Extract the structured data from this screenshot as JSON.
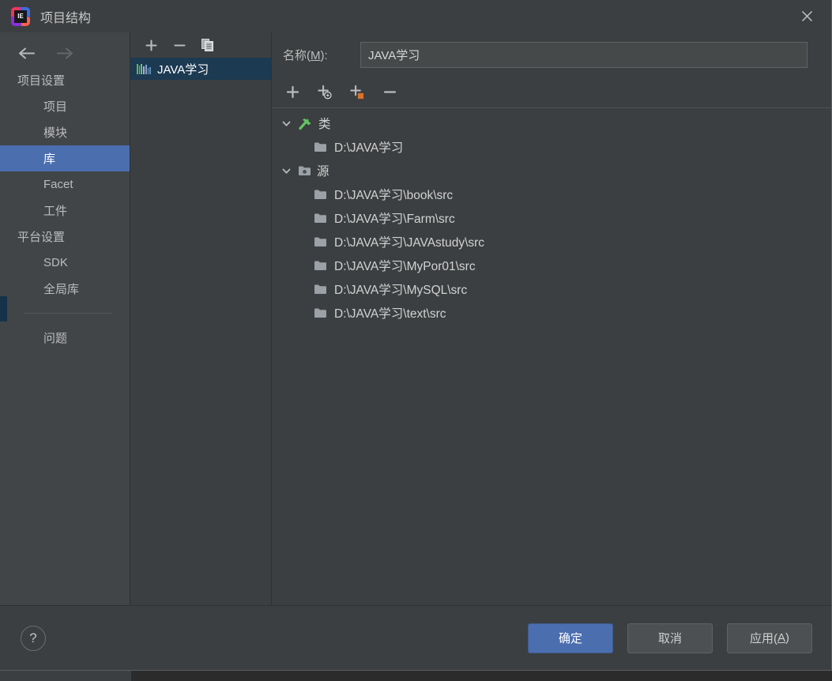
{
  "window": {
    "title": "项目结构",
    "app_icon": "intellij-idea-logo",
    "logo_badge": "IE",
    "close_icon": "close-icon"
  },
  "sidebar": {
    "back_icon": "arrow-left-icon",
    "forward_icon": "arrow-right-icon",
    "items": [
      {
        "label": "项目设置",
        "type": "group",
        "selected": false
      },
      {
        "label": "项目",
        "type": "child",
        "selected": false
      },
      {
        "label": "模块",
        "type": "child",
        "selected": false
      },
      {
        "label": "库",
        "type": "child",
        "selected": true
      },
      {
        "label": "Facet",
        "type": "child",
        "selected": false
      },
      {
        "label": "工件",
        "type": "child",
        "selected": false
      },
      {
        "label": "平台设置",
        "type": "group",
        "selected": false
      },
      {
        "label": "SDK",
        "type": "child",
        "selected": false
      },
      {
        "label": "全局库",
        "type": "child",
        "selected": false
      }
    ],
    "after_separator": [
      {
        "label": "问题",
        "type": "child",
        "selected": false
      }
    ]
  },
  "libraries_panel": {
    "toolbar": [
      {
        "name": "add-library-button",
        "icon": "plus-icon"
      },
      {
        "name": "remove-library-button",
        "icon": "minus-icon"
      },
      {
        "name": "copy-library-button",
        "icon": "copy-icon"
      }
    ],
    "items": [
      {
        "label": "JAVA学习",
        "icon": "library-icon",
        "selected": true
      }
    ]
  },
  "detail": {
    "name_label_prefix": "名称(",
    "name_label_mnemonic": "M",
    "name_label_suffix": "):",
    "name_value": "JAVA学习",
    "name_placeholder": "名称",
    "toolbar": [
      {
        "name": "add-path-button",
        "icon": "plus-icon"
      },
      {
        "name": "add-jar-directory-button",
        "icon": "plus-circle-icon"
      },
      {
        "name": "add-excluded-button",
        "icon": "plus-orange-icon"
      },
      {
        "name": "remove-path-button",
        "icon": "minus-icon"
      }
    ],
    "tree": [
      {
        "label": "类",
        "icon": "compiled-classes-icon",
        "expanded": true,
        "chevron": "chevron-down-icon",
        "children": [
          {
            "label": "D:\\JAVA学习",
            "icon": "folder-icon"
          }
        ]
      },
      {
        "label": "源",
        "icon": "sources-folder-icon",
        "expanded": true,
        "chevron": "chevron-down-icon",
        "children": [
          {
            "label": "D:\\JAVA学习\\book\\src",
            "icon": "folder-icon"
          },
          {
            "label": "D:\\JAVA学习\\Farm\\src",
            "icon": "folder-icon"
          },
          {
            "label": "D:\\JAVA学习\\JAVAstudy\\src",
            "icon": "folder-icon"
          },
          {
            "label": "D:\\JAVA学习\\MyPor01\\src",
            "icon": "folder-icon"
          },
          {
            "label": "D:\\JAVA学习\\MySQL\\src",
            "icon": "folder-icon"
          },
          {
            "label": "D:\\JAVA学习\\text\\src",
            "icon": "folder-icon"
          }
        ]
      }
    ]
  },
  "footer": {
    "help_icon": "help-icon",
    "help_label": "?",
    "ok_label": "确定",
    "cancel_label": "取消",
    "apply_prefix": "应用(",
    "apply_mnemonic": "A",
    "apply_suffix": ")"
  },
  "colors": {
    "dialog_bg": "#3c3f41",
    "sidebar_bg": "#414548",
    "selection_blue": "#4b6eaf",
    "list_selection": "#1c3a52",
    "text": "#bbbbbb",
    "accent_orange": "#d9823b",
    "accent_green": "#5fb85f"
  }
}
